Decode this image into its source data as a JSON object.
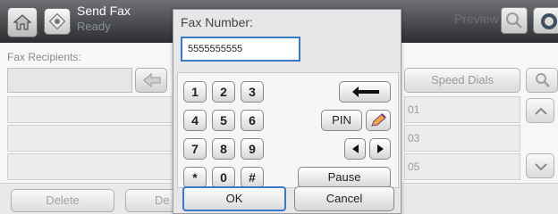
{
  "header": {
    "title": "Send Fax",
    "status": "Ready",
    "preview_label": "Preview",
    "home_icon": "home-icon",
    "fax_icon": "fax-icon",
    "help_icon": "help-icon"
  },
  "main": {
    "recipients_label": "Fax Recipients:",
    "speed_dials_label": "Speed Dials",
    "rows": [
      "01",
      "03",
      "05"
    ],
    "delete_label": "Delete",
    "delete_all_label": "De"
  },
  "dialog": {
    "title": "Fax Number:",
    "fax_value": "5555555555",
    "keys": [
      "1",
      "2",
      "3",
      "4",
      "5",
      "6",
      "7",
      "8",
      "9",
      "*",
      "0",
      "#"
    ],
    "pin_label": "PIN",
    "pause_label": "Pause",
    "ok_label": "OK",
    "cancel_label": "Cancel"
  },
  "colors": {
    "accent": "#3a78c9",
    "topbar": "#3a3b3f"
  }
}
